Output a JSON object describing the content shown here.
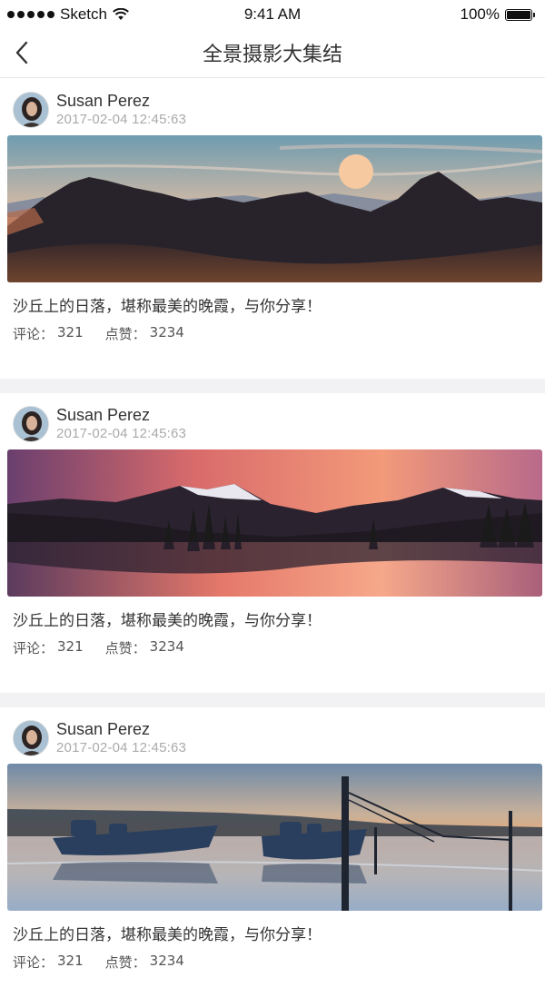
{
  "status_bar": {
    "carrier": "Sketch",
    "time": "9:41 AM",
    "battery": "100%"
  },
  "nav": {
    "title": "全景摄影大集结",
    "back_icon": "chevron-left-icon"
  },
  "posts": [
    {
      "username": "Susan Perez",
      "timestamp": "2017-02-04  12:45:63",
      "caption": "沙丘上的日落，堪称最美的晚霞，与你分享！",
      "comments_label": "评论：",
      "comments": "321",
      "likes_label": "点赞：",
      "likes": "3234"
    },
    {
      "username": "Susan Perez",
      "timestamp": "2017-02-04  12:45:63",
      "caption": "沙丘上的日落，堪称最美的晚霞，与你分享！",
      "comments_label": "评论：",
      "comments": "321",
      "likes_label": "点赞：",
      "likes": "3234"
    },
    {
      "username": "Susan Perez",
      "timestamp": "2017-02-04  12:45:63",
      "caption": "沙丘上的日落，堪称最美的晚霞，与你分享！",
      "comments_label": "评论：",
      "comments": "321",
      "likes_label": "点赞：",
      "likes": "3234"
    }
  ]
}
